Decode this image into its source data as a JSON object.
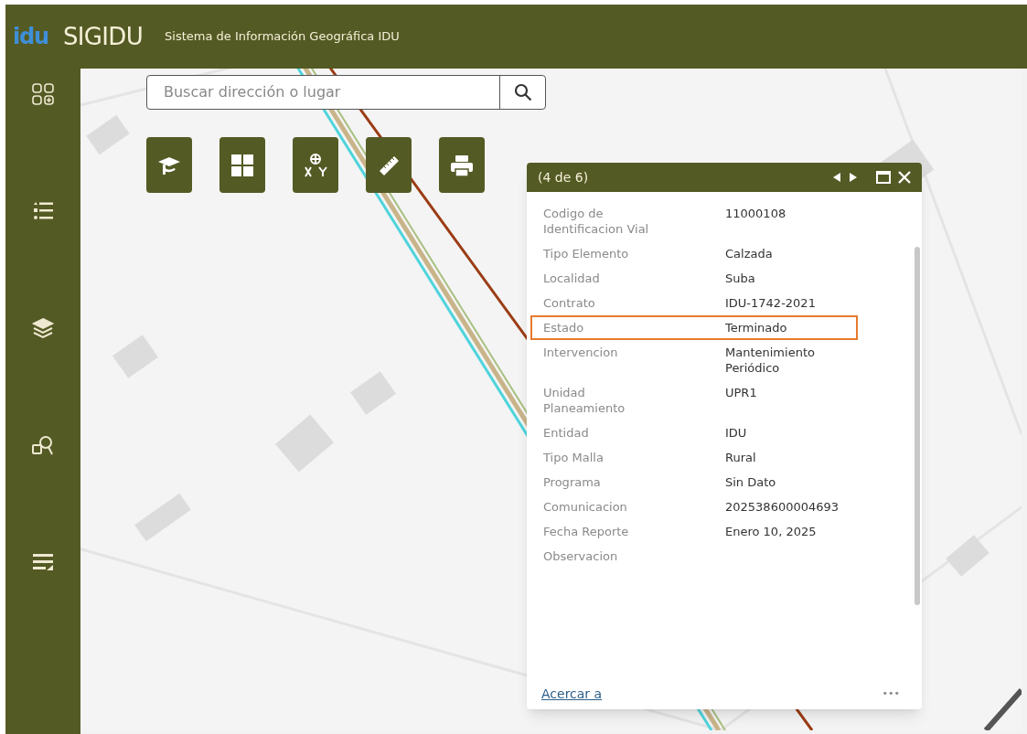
{
  "header": {
    "logo": "idu",
    "title": "SIGIDU",
    "subtitle": "Sistema de Información Geográfica IDU"
  },
  "sidebar": {
    "items": [
      {
        "kind": "widgets"
      },
      {
        "kind": "legend"
      },
      {
        "kind": "layers"
      },
      {
        "kind": "query"
      },
      {
        "kind": "list"
      }
    ]
  },
  "search": {
    "placeholder": "Buscar dirección o lugar"
  },
  "toolbar": [
    {
      "kind": "graduation"
    },
    {
      "kind": "basemap"
    },
    {
      "kind": "coordinates"
    },
    {
      "kind": "measure"
    },
    {
      "kind": "print"
    }
  ],
  "popup": {
    "title": "(4 de 6)",
    "fields": [
      {
        "label": "Codigo de Identificacion Vial",
        "value": "11000108",
        "highlighted": false
      },
      {
        "label": "Tipo Elemento",
        "value": "Calzada",
        "highlighted": false
      },
      {
        "label": "Localidad",
        "value": "Suba",
        "highlighted": false
      },
      {
        "label": "Contrato",
        "value": "IDU-1742-2021",
        "highlighted": false
      },
      {
        "label": "Estado",
        "value": "Terminado",
        "highlighted": true
      },
      {
        "label": "Intervencion",
        "value": "Mantenimiento Periódico",
        "highlighted": false
      },
      {
        "label": "Unidad Planeamiento",
        "value": "UPR1",
        "highlighted": false
      },
      {
        "label": "Entidad",
        "value": "IDU",
        "highlighted": false
      },
      {
        "label": "Tipo Malla",
        "value": "Rural",
        "highlighted": false
      },
      {
        "label": "Programa",
        "value": "Sin Dato",
        "highlighted": false
      },
      {
        "label": "Comunicacion",
        "value": "202538600004693",
        "highlighted": false
      },
      {
        "label": "Fecha Reporte",
        "value": "Enero 10, 2025",
        "highlighted": false
      },
      {
        "label": "Observacion",
        "highlighted": false
      }
    ],
    "link": "Acercar a",
    "more": "•••"
  }
}
